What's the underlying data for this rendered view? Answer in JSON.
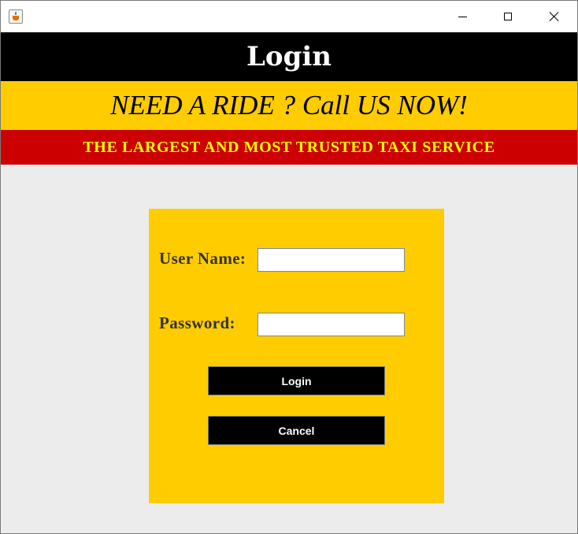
{
  "window": {
    "title": "",
    "app_icon": "java-coffee-cup-icon",
    "controls": {
      "minimize": "minimize-icon",
      "maximize": "maximize-icon",
      "close": "close-icon"
    }
  },
  "header": {
    "title": "Login",
    "slogan": "NEED A RIDE ? Call US NOW!",
    "tagline": "THE LARGEST AND MOST TRUSTED TAXI SERVICE"
  },
  "form": {
    "username_label": "User Name:",
    "username_value": "",
    "password_label": "Password:",
    "password_value": "",
    "login_button": "Login",
    "cancel_button": "Cancel"
  },
  "colors": {
    "title_band": "#000000",
    "slogan_band": "#ffcc00",
    "tagline_band": "#cc0000",
    "tagline_text": "#ffff00",
    "panel": "#ffcc00",
    "button": "#000000",
    "background": "#ececec"
  }
}
